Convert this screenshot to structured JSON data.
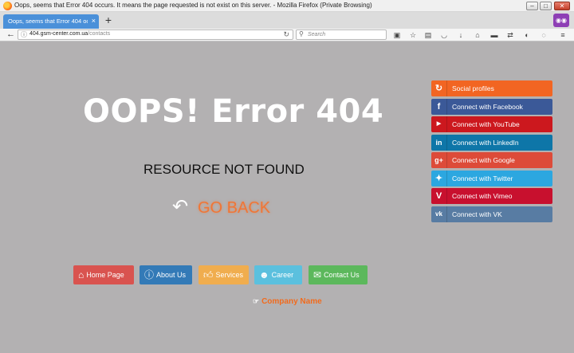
{
  "window": {
    "title": "Oops, seems that Error 404 occurs. It means the page requested is not exist on this server. - Mozilla Firefox (Private Browsing)",
    "min_label": "–",
    "max_label": "□",
    "close_label": "✕"
  },
  "tabs": {
    "active_label": "Oops, seems that Error 404 occurs...",
    "close_label": "×",
    "new_tab_label": "+"
  },
  "navbar": {
    "url_host": "404.gsm-center.com.ua",
    "url_path": "/contacts",
    "search_placeholder": "Search"
  },
  "page": {
    "heading": "OOPS! Error 404",
    "subheading": "RESOURCE NOT FOUND",
    "go_back": "GO BACK",
    "company": "Company Name",
    "nav_buttons": [
      {
        "label": "Home Page",
        "icon": "home-icon",
        "color": "#d9534f"
      },
      {
        "label": "About Us",
        "icon": "info-icon",
        "color": "#337ab7"
      },
      {
        "label": "Services",
        "icon": "thumbs-up-icon",
        "color": "#f0ad4e"
      },
      {
        "label": "Career",
        "icon": "users-icon",
        "color": "#5bc0de"
      },
      {
        "label": "Contact Us",
        "icon": "comments-icon",
        "color": "#5cb85c"
      }
    ]
  },
  "social": {
    "items": [
      {
        "label": "Social profiles",
        "icon": "refresh-icon",
        "color": "#f26522"
      },
      {
        "label": "Connect with Facebook",
        "icon": "facebook-icon",
        "color": "#3b5998"
      },
      {
        "label": "Connect with YouTube",
        "icon": "youtube-icon",
        "color": "#cc181e"
      },
      {
        "label": "Connect with LinkedIn",
        "icon": "linkedin-icon",
        "color": "#0e76a8"
      },
      {
        "label": "Connect with Google",
        "icon": "google-plus-icon",
        "color": "#dd4b39"
      },
      {
        "label": "Connect with Twitter",
        "icon": "twitter-icon",
        "color": "#2ca7e0"
      },
      {
        "label": "Connect with Vimeo",
        "icon": "vimeo-icon",
        "color": "#c8102e"
      },
      {
        "label": "Connect with VK",
        "icon": "vk-icon",
        "color": "#587ca3"
      }
    ]
  }
}
